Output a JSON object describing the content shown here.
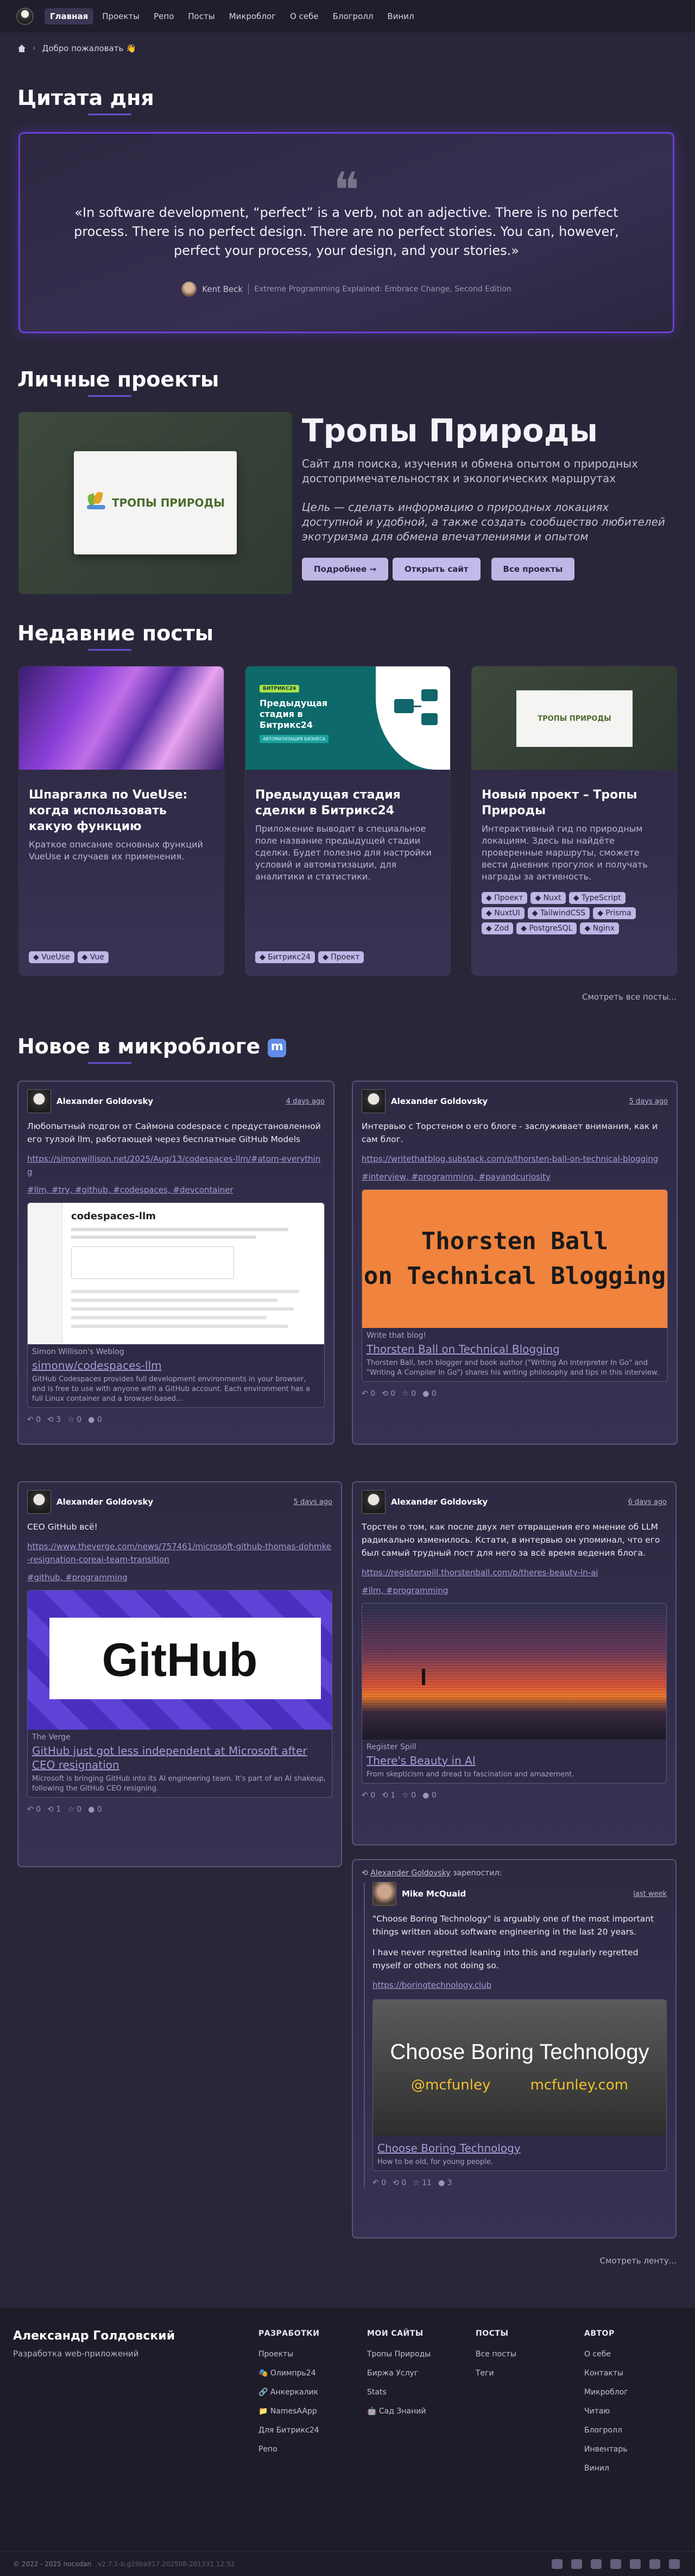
{
  "nav": {
    "items": [
      "Главная",
      "Проекты",
      "Репо",
      "Посты",
      "Микроблог",
      "О себе",
      "Блогролл",
      "Винил"
    ],
    "active": 0
  },
  "breadcrumb": {
    "text": "Добро пожаловать 👋"
  },
  "quote_section": {
    "title": "Цитата дня",
    "text": "«In software development, “perfect” is a verb, not an adjective. There is no perfect process. There is no perfect design. There are no perfect stories. You can, however, perfect your process, your design, and your stories.»",
    "author": "Kent Beck",
    "source": "Extreme Programming Explained: Embrace Change, Second Edition"
  },
  "projects": {
    "title": "Личные проекты",
    "name": "Тропы Природы",
    "logo_text": "ТРОПЫ ПРИРОДЫ",
    "description": "Сайт для поиска, изучения и обмена опытом о природных достопримечательностях и экологических маршрутах",
    "goal": "Цель — сделать информацию о природных локациях доступной и удобной, а также создать сообщество любителей экотуризма для обмена впечатлениями и опытом",
    "buttons": [
      "Подробнее →",
      "Открыть сайт",
      "Все проекты"
    ]
  },
  "posts": {
    "title": "Недавние посты",
    "more": "Смотреть все посты...",
    "items": [
      {
        "title": "Шпаргалка по VueUse: когда использовать какую функцию",
        "desc": "Краткое описание основных функций VueUse и случаев их применения.",
        "tags": [
          "VueUse",
          "Vue"
        ]
      },
      {
        "title": "Предыдущая стадия сделки в Битрикс24",
        "desc": "Приложение выводит в специальное поле название предыдущей стадии сделки. Будет полезно для настройки условий и автоматизации, для аналитики и статистики.",
        "tags": [
          "Битрикс24",
          "Проект"
        ],
        "img_badge": "БИТРИКС24",
        "img_title": "Предыдущая стадия в Битрикс24",
        "img_sub": "АВТОМАТИЗАЦИЯ БИЗНЕСА"
      },
      {
        "title": "Новый проект – Тропы Природы",
        "desc": "Интерактивный гид по природным локациям. Здесь вы найдёте проверенные маршруты, сможете вести дневник прогулок и получать награды за активность.",
        "tags": [
          "Проект",
          "Nuxt",
          "TypeScript",
          "NuxtUI",
          "TailwindCSS",
          "Prisma",
          "Zod",
          "PostgreSQL",
          "Nginx"
        ]
      }
    ]
  },
  "micro": {
    "title": "Новое в микроблоге",
    "more": "Смотреть ленту...",
    "toots": [
      {
        "author": "Alexander Goldovsky",
        "date": "4 days ago",
        "text": "Любопытный подгон от Саймона codespace с предустановленной его тулзой llm, работающей через бесплатные GitHub Models",
        "link": "https://simonwillison.net/2025/Aug/13/codespaces-llm/#atom-everything",
        "tags": "#llm, #try, #github, #codespaces, #devcontainer",
        "site": "Simon Willison's Weblog",
        "ptitle": "simonw/codespaces-llm",
        "pdesc": "GitHub Codespaces provides full development environments in your browser, and is free to use with anyone with a GitHub account. Each environment has a full Linux container and a browser-based…",
        "img_label": "codespaces-llm",
        "actions": [
          "0",
          "3",
          "0",
          "0"
        ]
      },
      {
        "author": "Alexander Goldovsky",
        "date": "5 days ago",
        "text": "Интервью с Торстеном о его блоге - заслуживает внимания, как и сам блог.",
        "link": "https://writethatblog.substack.com/p/thorsten-ball-on-technical-blogging",
        "tags": "#interview, #programming, #payandcuriosity",
        "site": "Write that blog!",
        "ptitle": "Thorsten Ball on Technical Blogging",
        "pdesc": "Thorsten Ball, tech blogger and book author (\"Writing An Interpreter In Go\" and \"Writing A Compiler In Go\") shares his writing philosophy and tips in this interview.",
        "img_label": "Thorsten Ball\non Technical Blogging",
        "actions": [
          "0",
          "0",
          "0",
          "0"
        ]
      },
      {
        "author": "Alexander Goldovsky",
        "date": "5 days ago",
        "text": "CEO GitHub всё!",
        "link": "https://www.theverge.com/news/757461/microsoft-github-thomas-dohmke-resignation-coreai-team-transition",
        "tags": "#github, #programming",
        "site": "The Verge",
        "ptitle": "GitHub just got less independent at Microsoft after CEO resignation",
        "pdesc": "Microsoft is bringing GitHub into its AI engineering team. It's part of an AI shakeup, following the GitHub CEO resigning.",
        "img_label": "GitHub",
        "actions": [
          "0",
          "1",
          "0",
          "0"
        ]
      },
      {
        "author": "Alexander Goldovsky",
        "date": "6 days ago",
        "text": "Торстен о том, как после двух лет отвращения его мнение об LLM радикально изменилось. Кстати, в интервью он упоминал, что его был самый трудный пост для него за всё время ведения блога.",
        "link": "https://registerspill.thorstenball.com/p/theres-beauty-in-ai",
        "tags": "#llm, #programming",
        "site": "Register Spill",
        "ptitle": "There's Beauty in AI",
        "pdesc": "From skepticism and dread to fascination and amazement.",
        "actions": [
          "0",
          "1",
          "0",
          "0"
        ]
      },
      {
        "boost": "Alexander Goldovsky",
        "boost_suffix": "зарепостил:",
        "author": "Mike McQuaid",
        "date": "last week",
        "text": "\"Choose Boring Technology\" is arguably one of the most important things written about software engineering in the last 20 years.",
        "text2": "I have never regretted leaning into this and regularly regretted myself or others not doing so.",
        "link": "https://boringtechnology.club",
        "ptitle": "Choose Boring Technology",
        "pdesc": "How to be old, for young people.",
        "img_label": "Choose Boring Technology",
        "img_l": "@mcfunley",
        "img_r": "mcfunley.com",
        "actions": [
          "0",
          "0",
          "11",
          "3"
        ]
      }
    ]
  },
  "footer": {
    "name": "Александр Голдовский",
    "role": "Разработка web-приложений",
    "cols": [
      {
        "title": "РАЗРАБОТКИ",
        "links": [
          "Проекты",
          "🎭 Олимпрь24",
          "🔗 Анкеркалик",
          "📁 NamesAApp",
          "Для Битрикс24",
          "Репо"
        ]
      },
      {
        "title": "МОИ САЙТЫ",
        "links": [
          "Тропы Природы",
          "Биржа Услуг",
          "Stats",
          "🤖 Сад Знаний"
        ]
      },
      {
        "title": "ПОСТЫ",
        "links": [
          "Все посты",
          "Теги"
        ]
      },
      {
        "title": "АВТОР",
        "links": [
          "О себе",
          "Контакты",
          "Микроблог",
          "Читаю",
          "Блогролл",
          "Инвентарь",
          "Винил"
        ]
      }
    ],
    "copyright": "© 2022 - 2025 nocodan",
    "version": "v2.7.1-b.g29ba917.202508-201331 12:52"
  }
}
